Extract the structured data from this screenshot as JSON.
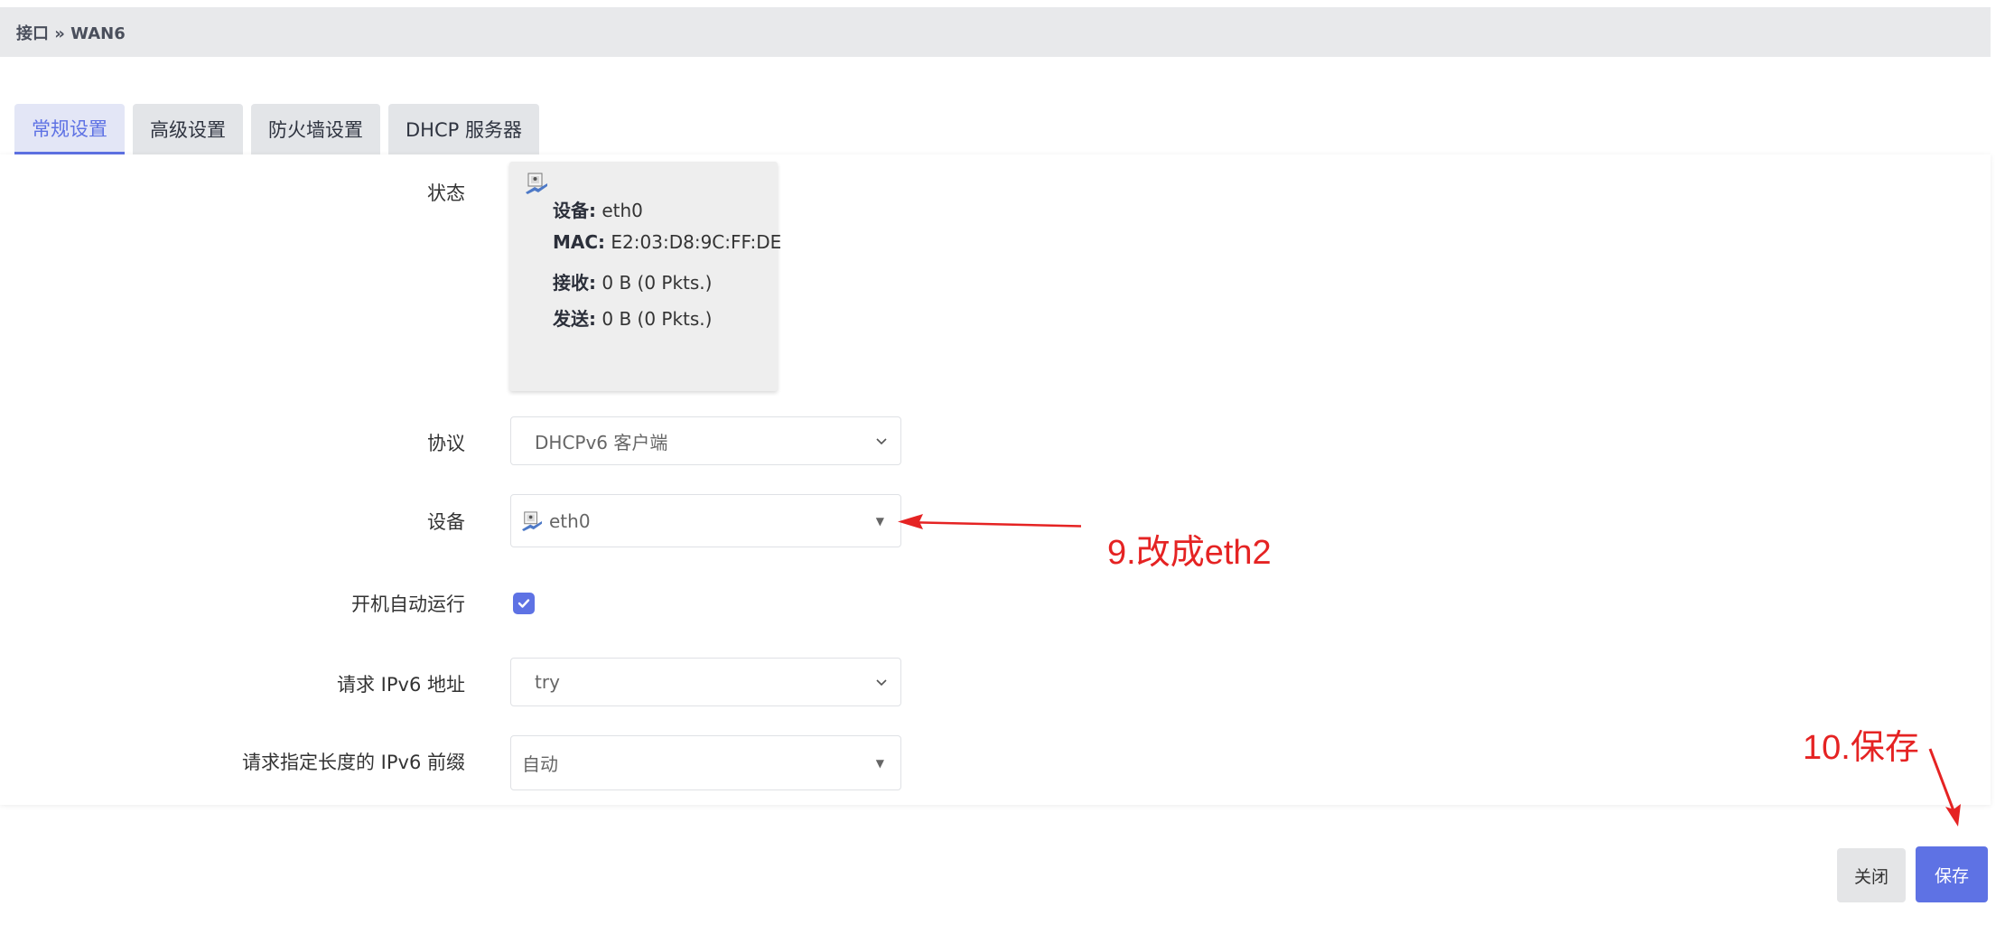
{
  "breadcrumb": {
    "text": "接口 » WAN6"
  },
  "tabs": [
    {
      "label": "常规设置",
      "active": true
    },
    {
      "label": "高级设置",
      "active": false
    },
    {
      "label": "防火墙设置",
      "active": false
    },
    {
      "label": "DHCP 服务器",
      "active": false
    }
  ],
  "form": {
    "status": {
      "label": "状态",
      "device_key": "设备:",
      "device_value": "eth0",
      "mac_key": "MAC:",
      "mac_value": "E2:03:D8:9C:FF:DE",
      "rx_key": "接收:",
      "rx_value": "0 B (0 Pkts.)",
      "tx_key": "发送:",
      "tx_value": "0 B (0 Pkts.)"
    },
    "protocol": {
      "label": "协议",
      "value": "DHCPv6 客户端"
    },
    "device": {
      "label": "设备",
      "value": "eth0"
    },
    "autostart": {
      "label": "开机自动运行",
      "checked": true
    },
    "request_ipv6": {
      "label": "请求 IPv6 地址",
      "value": "try"
    },
    "prefix_length": {
      "label": "请求指定长度的 IPv6 前缀",
      "value": "自动"
    }
  },
  "buttons": {
    "close": "关闭",
    "save": "保存"
  },
  "annotations": {
    "step9": "9.改成eth2",
    "step10": "10.保存"
  },
  "colors": {
    "accent": "#5e72e4",
    "annotation": "#e52323"
  }
}
